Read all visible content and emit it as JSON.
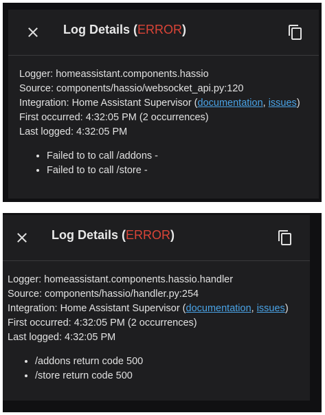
{
  "dialogs": [
    {
      "header": {
        "title_prefix": "Log Details (",
        "level": "ERROR",
        "title_suffix": ")"
      },
      "logger_label": "Logger: ",
      "logger": "homeassistant.components.hassio",
      "source_label": "Source: ",
      "source": "components/hassio/websocket_api.py:120",
      "integration_label": "Integration: ",
      "integration": "Home Assistant Supervisor",
      "documentation_link": "documentation",
      "issues_link": "issues",
      "first_occurred_label": "First occurred: ",
      "first_occurred": "4:32:05 PM (2 occurrences)",
      "last_logged_label": "Last logged: ",
      "last_logged": "4:32:05 PM",
      "messages": [
        "Failed to to call /addons -",
        "Failed to to call /store -"
      ]
    },
    {
      "header": {
        "title_prefix": "Log Details (",
        "level": "ERROR",
        "title_suffix": ")"
      },
      "logger_label": "Logger: ",
      "logger": "homeassistant.components.hassio.handler",
      "source_label": "Source: ",
      "source": "components/hassio/handler.py:254",
      "integration_label": "Integration: ",
      "integration": "Home Assistant Supervisor",
      "documentation_link": "documentation",
      "issues_link": "issues",
      "first_occurred_label": "First occurred: ",
      "first_occurred": "4:32:05 PM (2 occurrences)",
      "last_logged_label": "Last logged: ",
      "last_logged": "4:32:05 PM",
      "messages": [
        "/addons return code 500",
        "/store return code 500"
      ]
    }
  ],
  "colors": {
    "dialog_bg": "#1e1e20",
    "error": "#db4437",
    "link": "#4aa3e6",
    "text": "#e1e1e1"
  },
  "icons": [
    "close-icon",
    "copy-icon"
  ]
}
